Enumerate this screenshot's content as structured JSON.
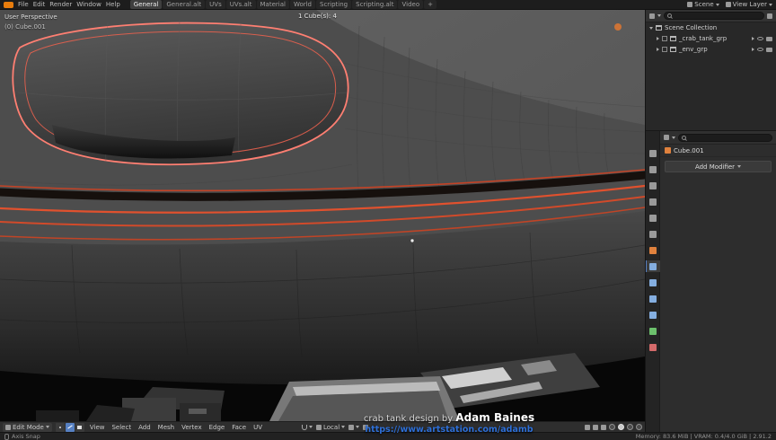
{
  "topbar": {
    "menus": [
      "File",
      "Edit",
      "Render",
      "Window",
      "Help"
    ],
    "tabs": [
      "General",
      "General.alt",
      "UVs",
      "UVs.alt",
      "Material",
      "World",
      "Scripting",
      "Scripting.alt",
      "Video",
      "+"
    ],
    "scene_label": "Scene",
    "view_layer_label": "View Layer"
  },
  "viewport": {
    "perspective_label": "User Perspective",
    "object_label": "(0) Cube.001",
    "stats": "1 Cube(s): 4",
    "footer": {
      "mode_label": "Edit Mode",
      "menus": [
        "View",
        "Select",
        "Add",
        "Mesh",
        "Vertex",
        "Edge",
        "Face",
        "UV"
      ],
      "orientation_label": "Local"
    }
  },
  "watermark": {
    "credit_prefix": "crab tank design by ",
    "credit_name": "Adam Baines",
    "url": "https://www.artstation.com/adamb"
  },
  "outliner": {
    "root": "Scene Collection",
    "items": [
      "_crab_tank_grp",
      "_env_grp"
    ]
  },
  "properties": {
    "object_name": "Cube.001",
    "add_modifier_label": "Add Modifier",
    "search_placeholder": ""
  },
  "statusbar": {
    "left_label": "Axis Snap",
    "right_label": "Memory: 83.6 MiB | VRAM: 0.4/4.0 GiB | 2.91.2"
  },
  "colors": {
    "accent_blue": "#4772b3",
    "selection_pink": "#ff7f72",
    "edge_select_red": "#e0512e",
    "url_blue": "#2e6fd6",
    "blender_orange": "#e87d0d"
  }
}
